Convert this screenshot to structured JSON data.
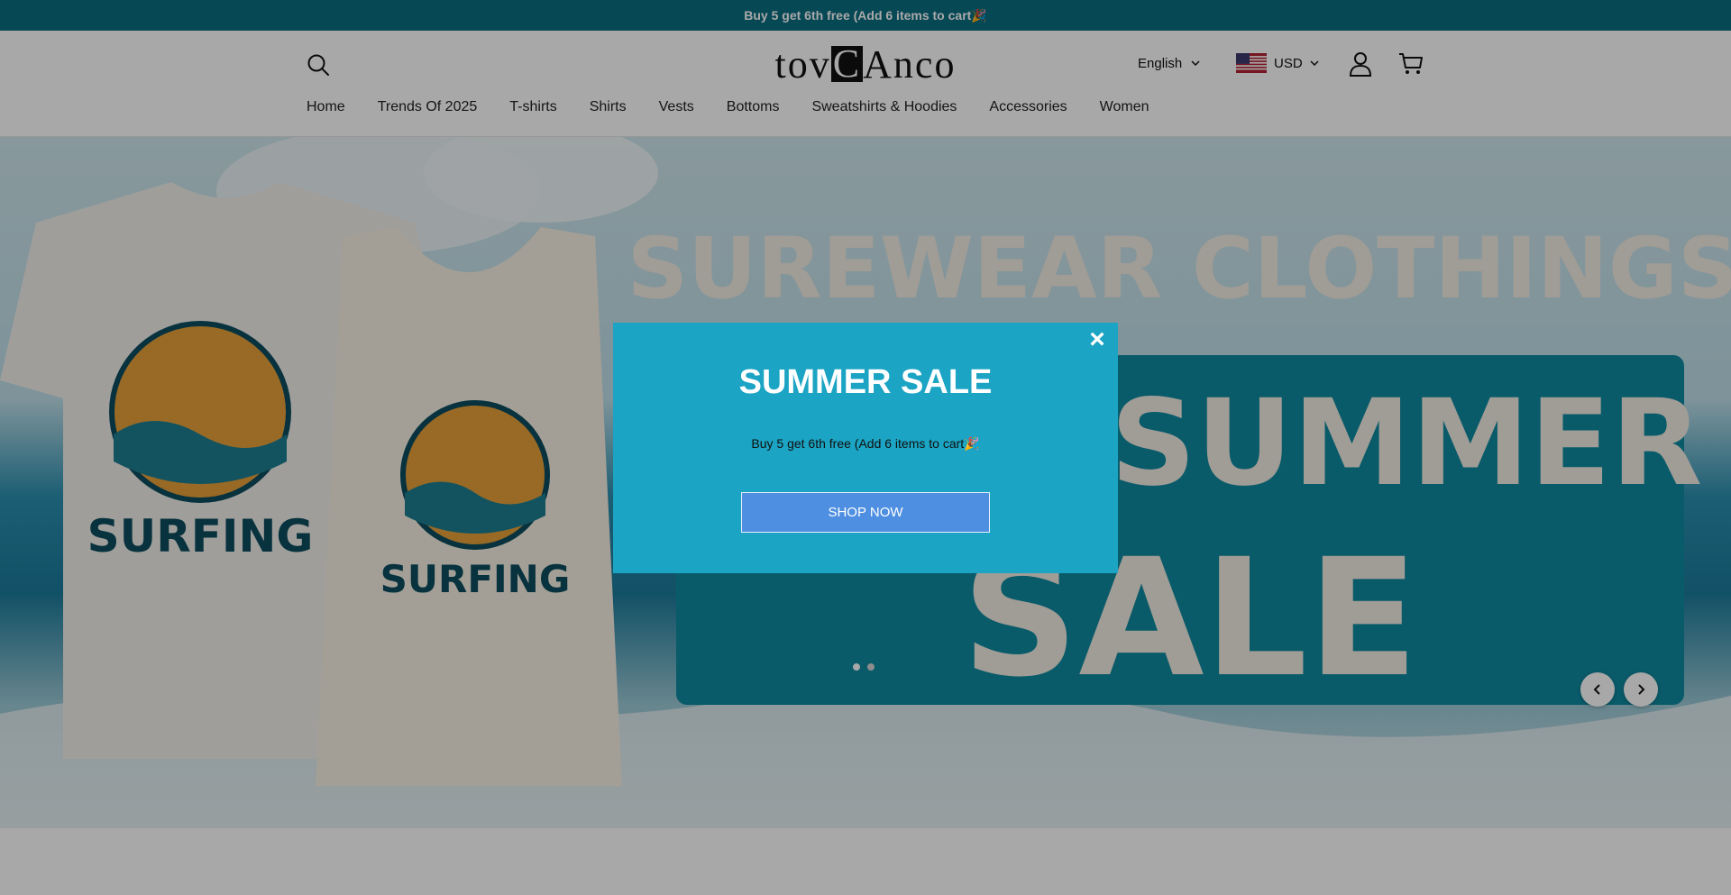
{
  "announcement": {
    "text": "Buy 5 get 6th free (Add 6 items to cart🎉"
  },
  "header": {
    "logo": {
      "before": "tov",
      "mark": "C",
      "after": "Anco"
    },
    "language": {
      "label": "English"
    },
    "currency": {
      "label": "USD"
    },
    "icons": {
      "search": "search-icon",
      "account": "user-icon",
      "cart": "cart-icon",
      "flag": "us-flag-icon",
      "chevron": "chevron-down-icon"
    }
  },
  "nav": {
    "items": [
      {
        "label": "Home"
      },
      {
        "label": "Trends Of 2025"
      },
      {
        "label": "T-shirts"
      },
      {
        "label": "Shirts"
      },
      {
        "label": "Vests"
      },
      {
        "label": "Bottoms"
      },
      {
        "label": "Sweatshirts & Hoodies"
      },
      {
        "label": "Accessories"
      },
      {
        "label": "Women"
      }
    ]
  },
  "hero": {
    "banner": {
      "headline": "SUREWEAR CLOTHINGS",
      "sale_line1": "SUMMER",
      "sale_line2": "SALE",
      "shirt_text": "SURFING"
    },
    "slides": {
      "count": 2,
      "active": 0
    },
    "controls": {
      "prev": "chevron-left-icon",
      "next": "chevron-right-icon"
    }
  },
  "popup": {
    "title": "SUMMER SALE",
    "text": "Buy 5 get 6th free (Add 6 items to cart🎉",
    "button": "SHOP NOW",
    "close": "×"
  },
  "colors": {
    "announcement_bg": "#0b6e82",
    "popup_bg": "#1ba4c3",
    "popup_button": "#4e8fe1",
    "sale_panel": "#0f8aa0",
    "banner_text": "#f3ede4"
  }
}
